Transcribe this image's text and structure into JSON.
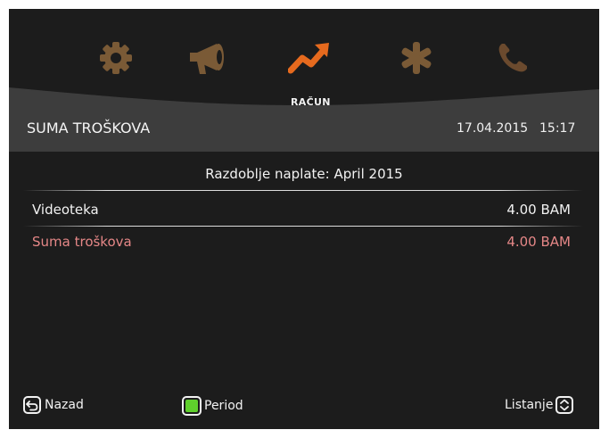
{
  "menu": {
    "icons": [
      {
        "name": "settings-gear-icon",
        "color": "#7a5a36"
      },
      {
        "name": "megaphone-icon",
        "color": "#7a5a36"
      },
      {
        "name": "trend-chart-icon",
        "color": "#e66a1e",
        "active": true
      },
      {
        "name": "asterisk-icon",
        "color": "#7a5a36"
      },
      {
        "name": "phone-icon",
        "color": "#6b4a2e"
      }
    ],
    "active_label": "RAČUN"
  },
  "header": {
    "title": "SUMA TROŠKOVA",
    "date": "17.04.2015",
    "time": "15:17"
  },
  "content": {
    "period": "Razdoblje naplate: April 2015",
    "rows": [
      {
        "name": "Videoteka",
        "value": "4.00 BAM"
      }
    ],
    "total": {
      "name": "Suma troškova",
      "value": "4.00 BAM",
      "color": "#e58787"
    }
  },
  "footer": {
    "back_label": "Nazad",
    "period_label": "Period",
    "scroll_label": "Listanje"
  }
}
